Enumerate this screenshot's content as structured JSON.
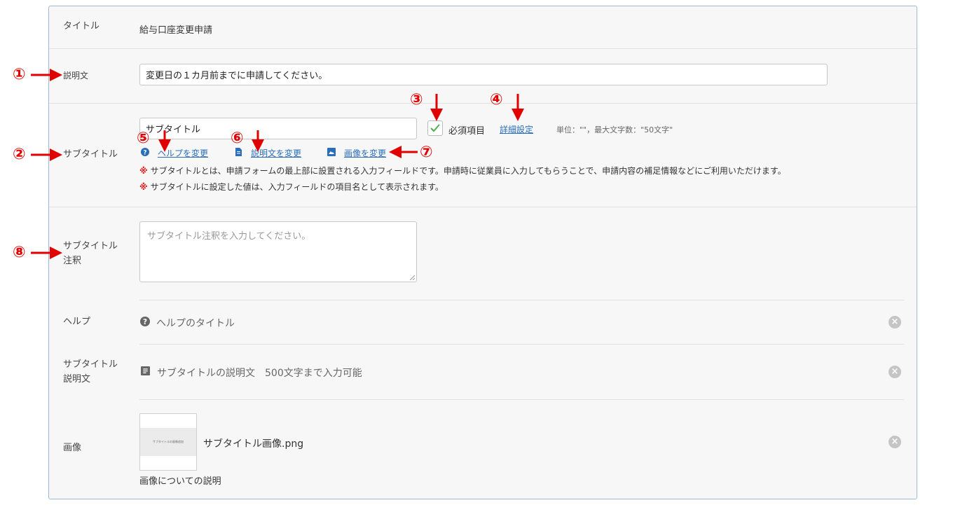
{
  "form": {
    "title_label": "タイトル",
    "title_value": "給与口座変更申請",
    "description_label": "説明文",
    "description_value": "変更日の１カ月前までに申請してください。",
    "subtitle_label": "サブタイトル",
    "subtitle_value": "サブタイトル",
    "required_label": "必須項目",
    "required_checked": true,
    "detail_settings_link": "詳細設定",
    "unit_info": "単位：\"\"，最大文字数：\"50文字\"",
    "change_help_link": "ヘルプを変更",
    "change_description_link": "説明文を変更",
    "change_image_link": "画像を変更",
    "note_mark": "※",
    "note_1": "サブタイトルとは、申請フォームの最上部に設置される入力フィールドです。申請時に従業員に入力してもらうことで、申請内容の補足情報などにご利用いただけます。",
    "note_2": "サブタイトルに設定した値は、入力フィールドの項目名として表示されます。",
    "annotation_label_line1": "サブタイトル",
    "annotation_label_line2": "注釈",
    "annotation_placeholder": "サブタイトル注釈を入力してください。",
    "help_label": "ヘルプ",
    "help_value": "ヘルプのタイトル",
    "subdesc_label_line1": "サブタイトル",
    "subdesc_label_line2": "説明文",
    "subdesc_value": "サブタイトルの説明文　500文字まで入力可能",
    "image_label": "画像",
    "image_thumb_text": "サブタイトルの画像追加",
    "image_filename": "サブタイトル画像.png",
    "image_caption": "画像についての説明"
  },
  "annotations": [
    "①",
    "②",
    "③",
    "④",
    "⑤",
    "⑥",
    "⑦",
    "⑧"
  ],
  "colors": {
    "accent": "#2a6ebb",
    "annotation": "#e00000",
    "panel_border": "#9fbad6",
    "check": "#4caf50"
  },
  "icons": {
    "help": "question-circle-icon",
    "description": "document-icon",
    "image": "image-icon",
    "close": "close-circle-icon"
  }
}
